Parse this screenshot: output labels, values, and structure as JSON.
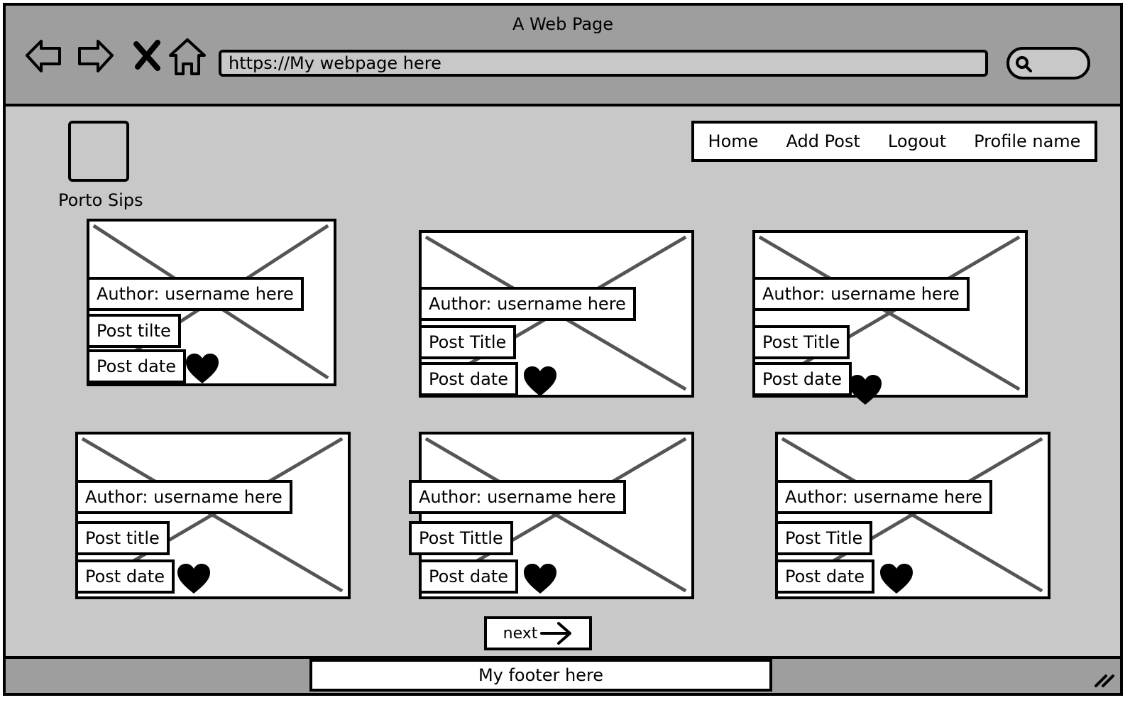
{
  "window": {
    "title": "A Web Page"
  },
  "browser": {
    "url": "https://My webpage here",
    "icons": [
      "back-arrow-icon",
      "forward-arrow-icon",
      "close-icon",
      "home-icon",
      "search-icon"
    ]
  },
  "site": {
    "name": "Porto Sips"
  },
  "nav": {
    "home": "Home",
    "add_post": "Add Post",
    "logout": "Logout",
    "profile": "Profile name"
  },
  "posts": [
    {
      "author": "Author: username here",
      "title": "Post tilte",
      "date": "Post date"
    },
    {
      "author": "Author: username here",
      "title": "Post Title",
      "date": "Post date"
    },
    {
      "author": "Author: username here",
      "title": "Post Title",
      "date": "Post date"
    },
    {
      "author": "Author: username here",
      "title": "Post title",
      "date": "Post date"
    },
    {
      "author": "Author: username here",
      "title": "Post Tittle",
      "date": "Post date"
    },
    {
      "author": "Author: username here",
      "title": "Post Title",
      "date": "Post date"
    }
  ],
  "pagination": {
    "next": "next"
  },
  "footer": {
    "text": "My footer here"
  }
}
